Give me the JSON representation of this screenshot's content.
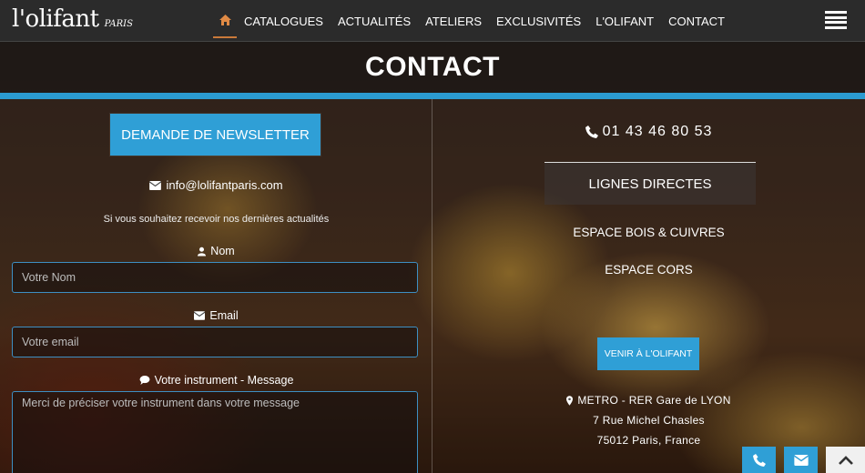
{
  "brand": {
    "name": "l'olifant",
    "subtitle": "PARIS"
  },
  "nav": {
    "items": [
      {
        "label": "CATALOGUES"
      },
      {
        "label": "ACTUALITÉS"
      },
      {
        "label": "ATELIERS"
      },
      {
        "label": "EXCLUSIVITÉS"
      },
      {
        "label": "L'OLIFANT"
      },
      {
        "label": "CONTACT"
      }
    ]
  },
  "page": {
    "title": "CONTACT"
  },
  "newsletter": {
    "button_label": "DEMANDE DE NEWSLETTER",
    "email": "info@lolifantparis.com",
    "subscribe_text": "Si vous souhaitez recevoir nos dernières actualités",
    "name_label": "Nom",
    "name_placeholder": "Votre Nom",
    "email_label": "Email",
    "email_placeholder": "Votre email",
    "message_label": "Votre instrument - Message",
    "message_placeholder": "Merci de préciser votre instrument dans votre message"
  },
  "contact": {
    "phone": "01 43 46 80 53",
    "lignes_label": "LIGNES DIRECTES",
    "line_1": "ESPACE BOIS & CUIVRES",
    "line_2": "ESPACE CORS",
    "venir_label": "VENIR À L'OLIFANT",
    "address_1": "METRO - RER Gare de LYON",
    "address_2": "7 Rue Michel Chasles",
    "address_3": "75012 Paris, France"
  },
  "colors": {
    "accent": "#2f9fd6",
    "nav_bg": "#2b2b2b",
    "home_underline": "#c9793a"
  },
  "icons": [
    "home-icon",
    "hamburger-menu-icon",
    "envelope-icon",
    "user-icon",
    "comment-icon",
    "phone-icon",
    "map-marker-icon",
    "chevron-up-icon"
  ]
}
